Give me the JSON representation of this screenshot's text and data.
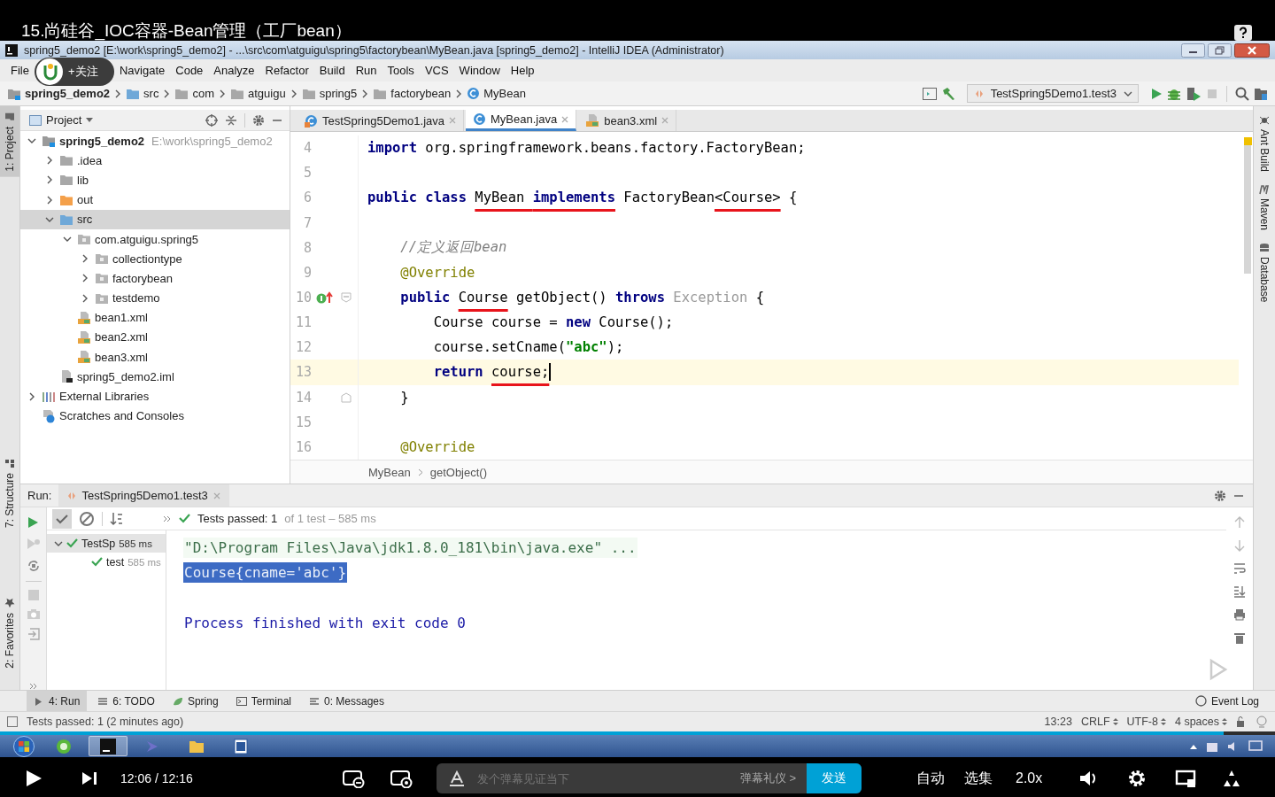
{
  "video": {
    "title": "15.尚硅谷_IOC容器-Bean管理（工厂bean）",
    "follow": "+关注"
  },
  "window": {
    "title": "spring5_demo2 [E:\\work\\spring5_demo2] - ...\\src\\com\\atguigu\\spring5\\factorybean\\MyBean.java [spring5_demo2] - IntelliJ IDEA (Administrator)"
  },
  "menu": [
    "File",
    "Navigate",
    "Code",
    "Analyze",
    "Refactor",
    "Build",
    "Run",
    "Tools",
    "VCS",
    "Window",
    "Help"
  ],
  "breadcrumbs": [
    {
      "label": "spring5_demo2",
      "kind": "module"
    },
    {
      "label": "src",
      "kind": "source"
    },
    {
      "label": "com",
      "kind": "folder"
    },
    {
      "label": "atguigu",
      "kind": "folder"
    },
    {
      "label": "spring5",
      "kind": "folder"
    },
    {
      "label": "factorybean",
      "kind": "folder"
    },
    {
      "label": "MyBean",
      "kind": "class"
    }
  ],
  "run_config": "TestSpring5Demo1.test3",
  "left_tabs": [
    {
      "label": "1: Project",
      "kind": "project",
      "selected": true
    },
    {
      "label": "7: Structure",
      "kind": "structure",
      "selected": false
    },
    {
      "label": "2: Favorites",
      "kind": "favorites",
      "selected": false
    }
  ],
  "right_tabs": [
    {
      "label": "Ant Build",
      "kind": "ant"
    },
    {
      "label": "Maven",
      "kind": "maven"
    },
    {
      "label": "Database",
      "kind": "database"
    }
  ],
  "project": {
    "title": "Project",
    "tree": [
      {
        "label": "spring5_demo2",
        "kind": "module",
        "hint": "E:\\work\\spring5_demo2",
        "expanded": true,
        "selected": false,
        "children": [
          {
            "label": ".idea",
            "kind": "folder",
            "expanded": false,
            "selected": false
          },
          {
            "label": "lib",
            "kind": "folder",
            "expanded": false,
            "selected": false
          },
          {
            "label": "out",
            "kind": "excluded",
            "expanded": false,
            "selected": false
          },
          {
            "label": "src",
            "kind": "source",
            "expanded": true,
            "selected": true,
            "children": [
              {
                "label": "com.atguigu.spring5",
                "kind": "package",
                "expanded": true,
                "selected": false,
                "children": [
                  {
                    "label": "collectiontype",
                    "kind": "package",
                    "expanded": false,
                    "selected": false
                  },
                  {
                    "label": "factorybean",
                    "kind": "package",
                    "expanded": false,
                    "selected": false
                  },
                  {
                    "label": "testdemo",
                    "kind": "package",
                    "expanded": false,
                    "selected": false
                  }
                ]
              },
              {
                "label": "bean1.xml",
                "kind": "xml",
                "selected": false
              },
              {
                "label": "bean2.xml",
                "kind": "xml",
                "selected": false
              },
              {
                "label": "bean3.xml",
                "kind": "xml",
                "selected": false
              }
            ]
          },
          {
            "label": "spring5_demo2.iml",
            "kind": "iml",
            "selected": false
          }
        ]
      },
      {
        "label": "External Libraries",
        "kind": "libraries",
        "expanded": false,
        "selected": false
      },
      {
        "label": "Scratches and Consoles",
        "kind": "scratches",
        "selected": false
      }
    ]
  },
  "editor": {
    "tabs": [
      {
        "label": "TestSpring5Demo1.java",
        "kind": "test",
        "selected": false
      },
      {
        "label": "MyBean.java",
        "kind": "class",
        "selected": true
      },
      {
        "label": "bean3.xml",
        "kind": "xml",
        "selected": false
      }
    ],
    "lines": [
      {
        "number": "4",
        "current": false,
        "overrides": false,
        "fold_start": false,
        "fold_end": false,
        "tokens": [
          {
            "kind": "kw",
            "text": "import"
          },
          {
            "kind": "plain",
            "text": " org.springframework.beans.factory.FactoryBean;"
          }
        ]
      },
      {
        "number": "5",
        "current": false,
        "overrides": false,
        "fold_start": false,
        "fold_end": false
      },
      {
        "number": "6",
        "current": false,
        "overrides": false,
        "fold_start": false,
        "fold_end": false,
        "tokens": [
          {
            "kind": "kw",
            "text": "public class "
          },
          {
            "kind": "plain",
            "text": "MyBean ",
            "underlined": true
          },
          {
            "kind": "kw",
            "text": "implements",
            "underlined": true
          },
          {
            "kind": "plain",
            "text": " FactoryBean"
          },
          {
            "kind": "plain",
            "text": "<Course>",
            "underlined": true
          },
          {
            "kind": "plain",
            "text": " {"
          }
        ]
      },
      {
        "number": "7",
        "current": false,
        "overrides": false,
        "fold_start": false,
        "fold_end": false
      },
      {
        "number": "8",
        "current": false,
        "overrides": false,
        "fold_start": false,
        "fold_end": false,
        "tokens": [
          {
            "kind": "comment",
            "text": "    //定义返回bean"
          }
        ]
      },
      {
        "number": "9",
        "current": false,
        "overrides": false,
        "fold_start": false,
        "fold_end": false,
        "tokens": [
          {
            "kind": "annot",
            "text": "    @Override"
          }
        ]
      },
      {
        "number": "10",
        "current": false,
        "overrides": true,
        "fold_start": true,
        "fold_end": false,
        "tokens": [
          {
            "kind": "kw",
            "text": "    public "
          },
          {
            "kind": "plain",
            "text": "Course",
            "underlined": true
          },
          {
            "kind": "plain",
            "text": " getObject() "
          },
          {
            "kind": "kw",
            "text": "throws"
          },
          {
            "kind": "muted",
            "text": " Exception"
          },
          {
            "kind": "plain",
            "text": " {"
          }
        ]
      },
      {
        "number": "11",
        "current": false,
        "overrides": false,
        "fold_start": false,
        "fold_end": false,
        "tokens": [
          {
            "kind": "plain",
            "text": "        Course course = "
          },
          {
            "kind": "kw",
            "text": "new"
          },
          {
            "kind": "plain",
            "text": " Course();"
          }
        ]
      },
      {
        "number": "12",
        "current": false,
        "overrides": false,
        "fold_start": false,
        "fold_end": false,
        "tokens": [
          {
            "kind": "plain",
            "text": "        course.setCname("
          },
          {
            "kind": "str",
            "text": "\"abc\""
          },
          {
            "kind": "plain",
            "text": ");"
          }
        ]
      },
      {
        "number": "13",
        "current": true,
        "overrides": false,
        "fold_start": false,
        "fold_end": false,
        "tokens": [
          {
            "kind": "kw",
            "text": "        return "
          },
          {
            "kind": "plain",
            "text": "course;",
            "underlined": true
          }
        ]
      },
      {
        "number": "14",
        "current": false,
        "overrides": false,
        "fold_start": false,
        "fold_end": true,
        "tokens": [
          {
            "kind": "plain",
            "text": "    }"
          }
        ]
      },
      {
        "number": "15",
        "current": false,
        "overrides": false,
        "fold_start": false,
        "fold_end": false
      },
      {
        "number": "16",
        "current": false,
        "overrides": false,
        "fold_start": false,
        "fold_end": false,
        "tokens": [
          {
            "kind": "annot",
            "text": "    @Override"
          }
        ]
      }
    ],
    "breadcrumbs": [
      "MyBean",
      "getObject()"
    ]
  },
  "run": {
    "label": "Run:",
    "tab": "TestSpring5Demo1.test3",
    "status": "Tests passed: 1",
    "status_detail": "of 1 test – 585 ms",
    "tests": [
      {
        "name": "TestSp",
        "time": "585 ms",
        "expanded": true,
        "children": [
          {
            "name": "test",
            "time": "585 ms"
          }
        ]
      }
    ],
    "console": [
      {
        "kind": "command",
        "text": "\"D:\\Program Files\\Java\\jdk1.8.0_181\\bin\\java.exe\" ...",
        "selected": false
      },
      {
        "kind": "output",
        "text": "Course{cname='abc'}",
        "selected": true
      },
      {
        "kind": "info",
        "text": "Process finished with exit code 0",
        "selected": false
      }
    ]
  },
  "tool_tabs": [
    {
      "label": "4: Run",
      "kind": "run",
      "selected": true
    },
    {
      "label": "6: TODO",
      "kind": "todo",
      "selected": false
    },
    {
      "label": "Spring",
      "kind": "spring",
      "selected": false
    },
    {
      "label": "Terminal",
      "kind": "terminal",
      "selected": false
    },
    {
      "label": "0: Messages",
      "kind": "messages",
      "selected": false
    }
  ],
  "event_log": "Event Log",
  "status": {
    "message": "Tests passed: 1 (2 minutes ago)",
    "position": "13:23",
    "line_ending": "CRLF",
    "encoding": "UTF-8",
    "indent": "4 spaces"
  },
  "player": {
    "level": 0.96,
    "time": "12:06 / 12:16",
    "danmaku_placeholder": "发个弹幕见证当下",
    "etiquette": "弹幕礼仪 >",
    "send": "发送",
    "auto": "自动",
    "episodes": "选集",
    "speed": "2.0x"
  }
}
